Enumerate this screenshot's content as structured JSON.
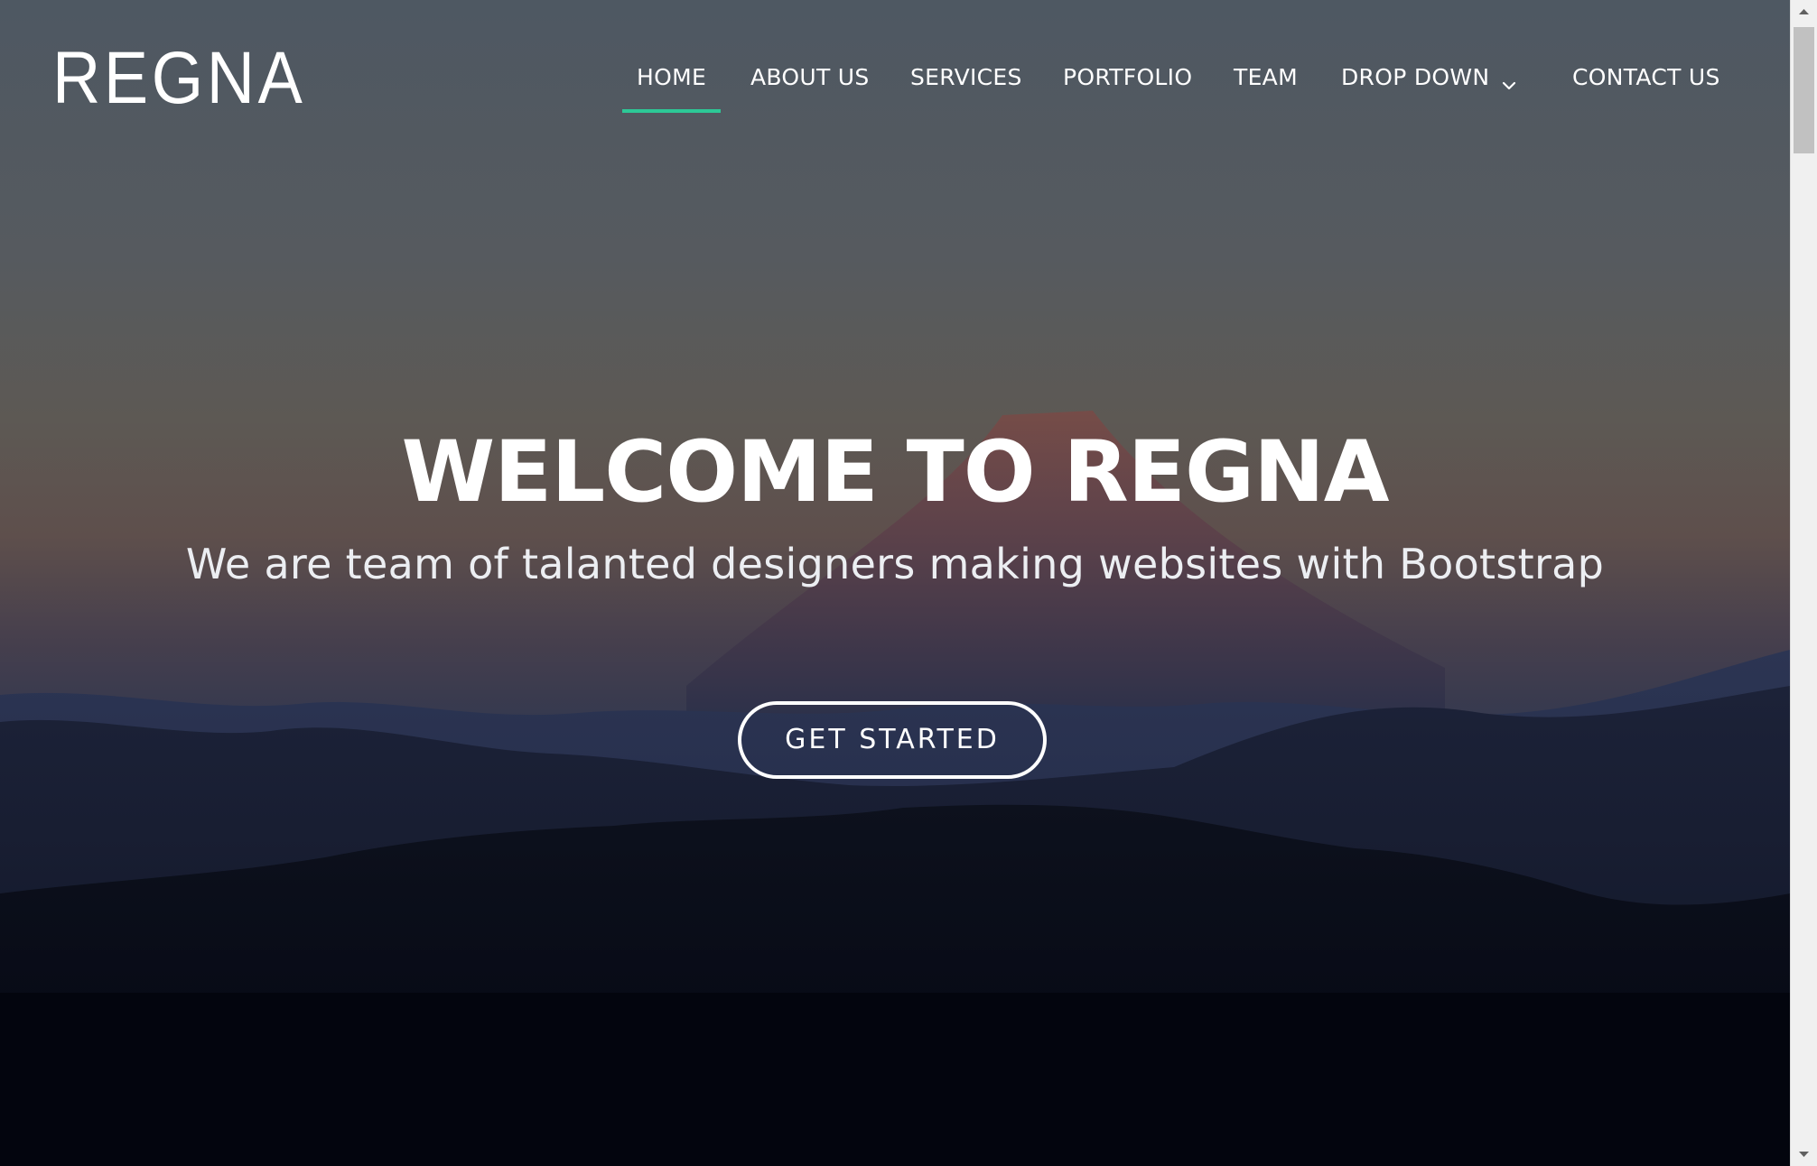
{
  "header": {
    "logo": "REGNA",
    "nav": [
      {
        "label": "HOME",
        "active": true
      },
      {
        "label": "ABOUT US",
        "active": false
      },
      {
        "label": "SERVICES",
        "active": false
      },
      {
        "label": "PORTFOLIO",
        "active": false
      },
      {
        "label": "TEAM",
        "active": false
      },
      {
        "label": "DROP DOWN",
        "active": false,
        "icon": "chevron-down-icon"
      },
      {
        "label": "CONTACT US",
        "active": false
      }
    ]
  },
  "hero": {
    "title": "WELCOME TO REGNA",
    "subtitle": "We are team of talanted designers making websites with Bootstrap",
    "cta_label": "GET STARTED"
  },
  "colors": {
    "accent": "#2dc997",
    "text": "#ffffff"
  },
  "scrollbar": {
    "up_icon": "scroll-up-arrow-icon",
    "down_icon": "scroll-down-arrow-icon"
  }
}
